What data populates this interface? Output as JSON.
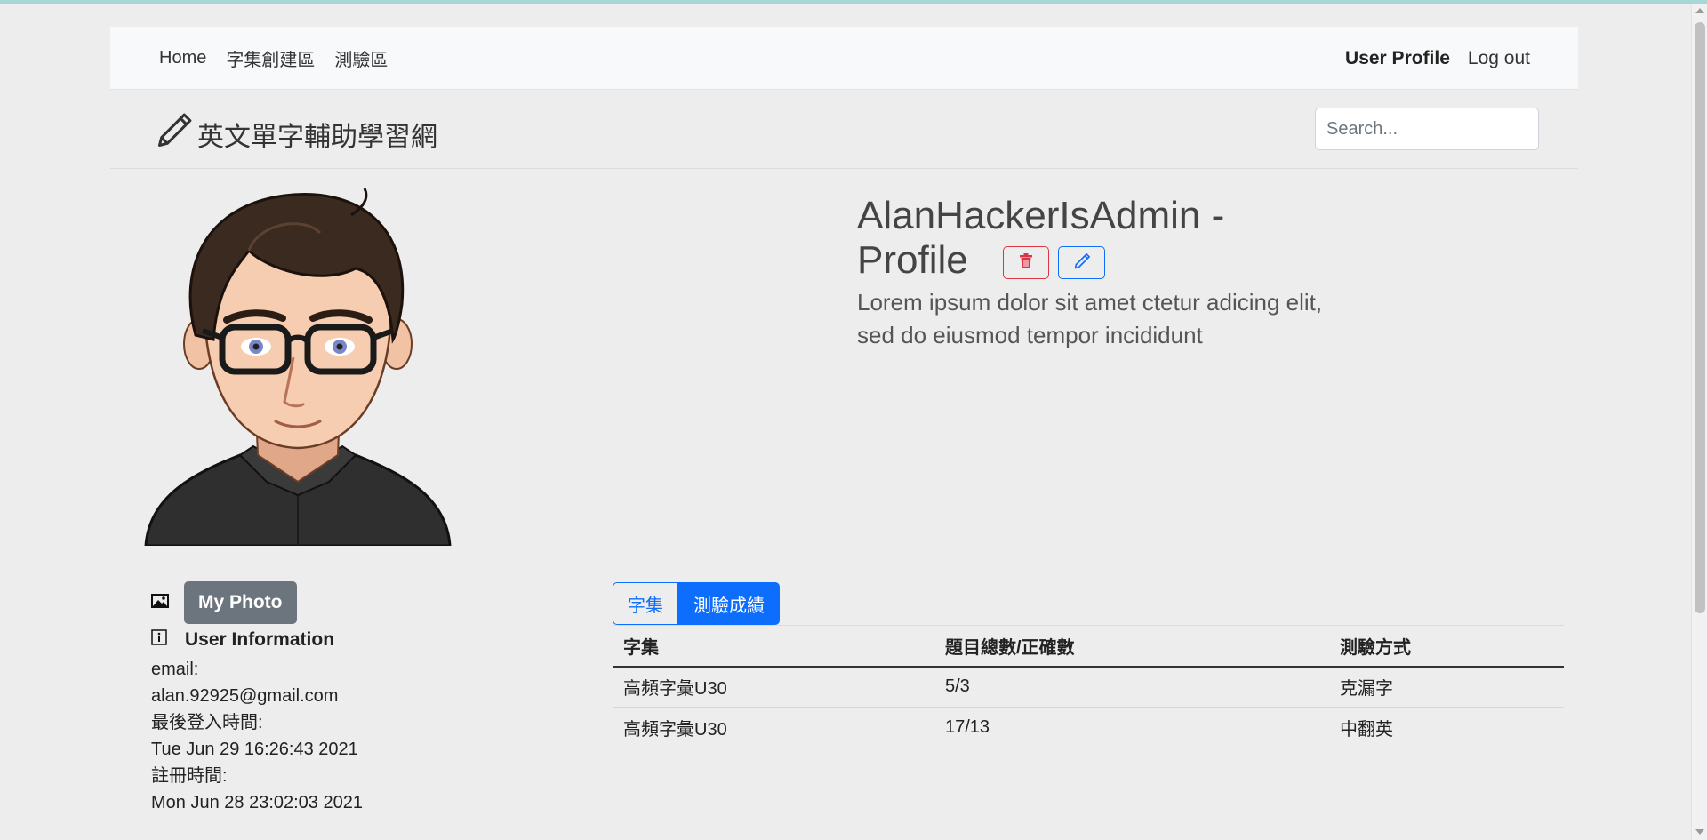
{
  "nav": {
    "left": [
      "Home",
      "字集創建區",
      "測驗區"
    ],
    "user_profile": "User Profile",
    "logout": "Log out"
  },
  "brand": {
    "title": "英文單字輔助學習網",
    "icon": "pencil-icon"
  },
  "search": {
    "placeholder": "Search..."
  },
  "profile": {
    "title_line1": "AlanHackerIsAdmin -",
    "title_line2": "Profile",
    "bio_line1": "Lorem ipsum dolor sit amet ctetur adicing elit,",
    "bio_line2": "sed do eiusmod tempor incididunt",
    "delete_icon": "trash-icon",
    "edit_icon": "pencil-icon"
  },
  "info": {
    "photo_button": "My Photo",
    "user_info_heading": "User Information",
    "email_label": "email:",
    "email_value": "alan.92925@gmail.com",
    "last_login_label": "最後登入時間:",
    "last_login_value": "Tue Jun 29 16:26:43 2021",
    "register_label": "註冊時間:",
    "register_value": "Mon Jun 28 23:02:03 2021"
  },
  "tabs": [
    "字集",
    "測驗成績"
  ],
  "table": {
    "headers": [
      "字集",
      "題目總數/正確數",
      "測驗方式"
    ],
    "rows": [
      [
        "高頻字彙U30",
        "5/3",
        "克漏字"
      ],
      [
        "高頻字彙U30",
        "17/13",
        "中翻英"
      ]
    ]
  },
  "colors": {
    "primary": "#0d6efd",
    "danger": "#dc3545",
    "secondary": "#6c757d"
  }
}
